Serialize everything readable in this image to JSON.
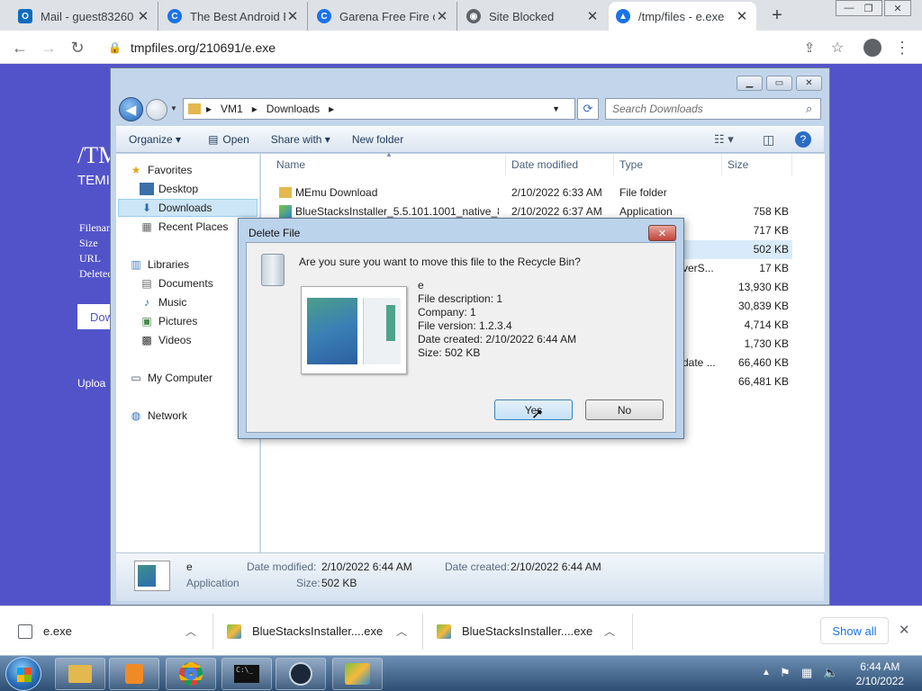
{
  "browser": {
    "tabs": [
      {
        "label": "Mail - guest83260",
        "icon": "outlook-icon",
        "color": "#0f6cbd"
      },
      {
        "label": "The Best Android E",
        "icon": "chrome-icon",
        "color": "#1a73e8"
      },
      {
        "label": "Garena Free Fire or",
        "icon": "chrome-icon",
        "color": "#1a73e8"
      },
      {
        "label": "Site Blocked",
        "icon": "globe-icon",
        "color": "#5f6368"
      },
      {
        "label": "/tmp/files - e.exe",
        "icon": "cloud-upload-icon",
        "color": "#1a73e8"
      }
    ],
    "url": "tmpfiles.org/210691/e.exe"
  },
  "site": {
    "title": "/TM",
    "subtitle": "TEMI",
    "labels": [
      "Filenam",
      "Size",
      "URL",
      "Deleted"
    ],
    "download_label": "Dow",
    "upload_label": "Uploa"
  },
  "explorer": {
    "breadcrumb": [
      "VM1",
      "Downloads"
    ],
    "search_placeholder": "Search Downloads",
    "commands": [
      "Organize",
      "Open",
      "Share with",
      "New folder"
    ],
    "nav": {
      "favorites": "Favorites",
      "desktop": "Desktop",
      "downloads": "Downloads",
      "recent": "Recent Places",
      "libraries": "Libraries",
      "documents": "Documents",
      "music": "Music",
      "pictures": "Pictures",
      "videos": "Videos",
      "computer": "My Computer",
      "network": "Network"
    },
    "columns": [
      "Name",
      "Date modified",
      "Type",
      "Size"
    ],
    "files": [
      {
        "name": "MEmu Download",
        "date": "2/10/2022 6:33 AM",
        "type": "File folder",
        "size": ""
      },
      {
        "name": "BlueStacksInstaller_5.5.101.1001_native_8...",
        "date": "2/10/2022 6:37 AM",
        "type": "Application",
        "size": "758 KB"
      },
      {
        "name": "",
        "date": "",
        "type": "",
        "size": "717 KB"
      },
      {
        "name": "",
        "date": "",
        "type": "",
        "size": "502 KB"
      },
      {
        "name": "",
        "date": "",
        "type": "verS...",
        "size": "17 KB"
      },
      {
        "name": "",
        "date": "",
        "type": "",
        "size": "13,930 KB"
      },
      {
        "name": "",
        "date": "",
        "type": "",
        "size": "30,839 KB"
      },
      {
        "name": "",
        "date": "",
        "type": "",
        "size": "4,714 KB"
      },
      {
        "name": "",
        "date": "",
        "type": "",
        "size": "1,730 KB"
      },
      {
        "name": "",
        "date": "",
        "type": "date ...",
        "size": "66,460 KB"
      },
      {
        "name": "",
        "date": "",
        "type": "",
        "size": "66,481 KB"
      }
    ],
    "details": {
      "name": "e",
      "type": "Application",
      "modified_label": "Date modified:",
      "modified_value": "2/10/2022 6:44 AM",
      "created_label": "Date created:",
      "created_value": "2/10/2022 6:44 AM",
      "size_label": "Size:",
      "size_value": "502 KB"
    }
  },
  "dialog": {
    "title": "Delete File",
    "question": "Are you sure you want to move this file to the Recycle Bin?",
    "info": [
      "e",
      "File description: 1",
      "Company: 1",
      "File version: 1.2.3.4",
      "Date created: 2/10/2022 6:44 AM",
      "Size: 502 KB"
    ],
    "yes": "Yes",
    "no": "No"
  },
  "downloads": {
    "items": [
      "e.exe",
      "BlueStacksInstaller....exe",
      "BlueStacksInstaller....exe"
    ],
    "show_all": "Show all"
  },
  "taskbar": {
    "time": "6:44 AM",
    "date": "2/10/2022"
  }
}
